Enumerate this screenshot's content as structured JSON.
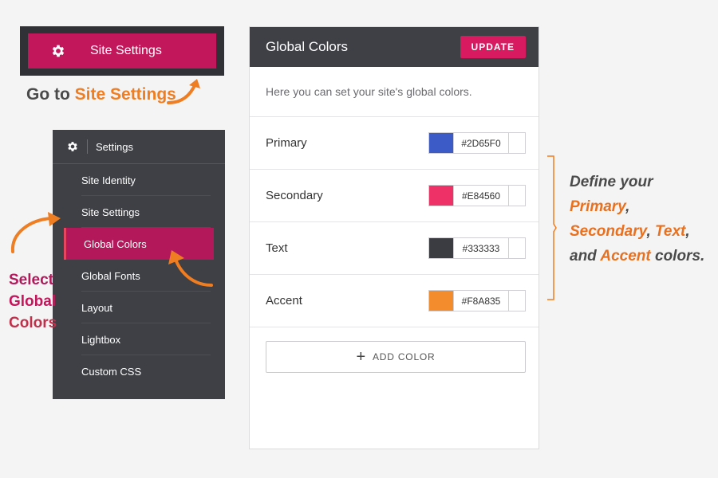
{
  "site_settings_button": {
    "label": "Site Settings",
    "icon": "gear-icon"
  },
  "goto_caption": {
    "prefix": "Go to ",
    "highlight": "Site Settings"
  },
  "settings_menu": {
    "header": "Settings",
    "items": [
      {
        "label": "Site Identity",
        "active": false
      },
      {
        "label": "Site Settings",
        "active": false
      },
      {
        "label": "Global Colors",
        "active": true
      },
      {
        "label": "Global Fonts",
        "active": false
      },
      {
        "label": "Layout",
        "active": false
      },
      {
        "label": "Lightbox",
        "active": false
      },
      {
        "label": "Custom CSS",
        "active": false
      }
    ]
  },
  "select_caption": {
    "line1": "Select",
    "line2": "Global",
    "line3": "Colors"
  },
  "panel": {
    "title": "Global Colors",
    "update_label": "UPDATE",
    "intro": "Here you can set your site's global colors.",
    "colors": [
      {
        "label": "Primary",
        "hex": "#2D65F0",
        "swatch": "#3d5bc7"
      },
      {
        "label": "Secondary",
        "hex": "#E84560",
        "swatch": "#ee3166"
      },
      {
        "label": "Text",
        "hex": "#333333",
        "swatch": "#3a3c42"
      },
      {
        "label": "Accent",
        "hex": "#F8A835",
        "swatch": "#f28c2c"
      }
    ],
    "add_color_label": "ADD COLOR"
  },
  "define_caption": {
    "l1": "Define your",
    "primary": "Primary",
    "comma1": ",",
    "secondary": "Secondary",
    "comma2": ", ",
    "text": "Text",
    "comma3": ",",
    "and": "and ",
    "accent": "Accent",
    "colors": " colors."
  },
  "colors": {
    "brand": "#c2185b",
    "accent_orange": "#ef7d22",
    "dark": "#3e4046"
  }
}
